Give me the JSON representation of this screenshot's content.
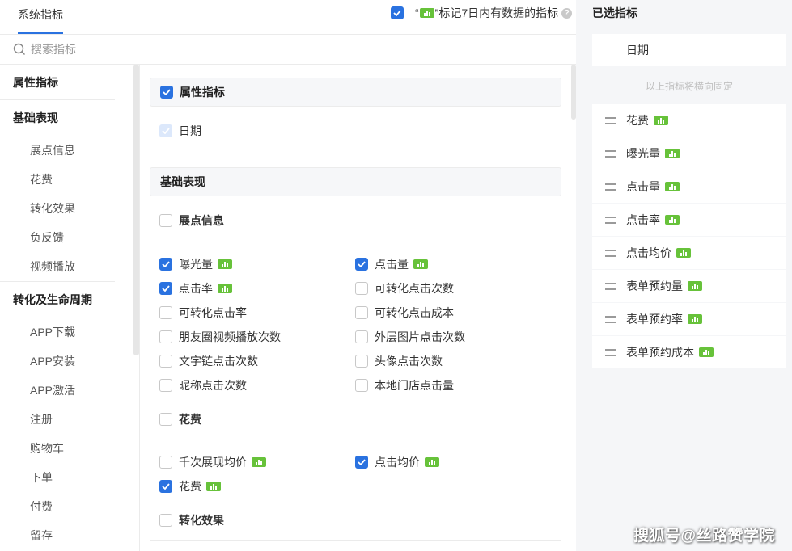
{
  "header": {
    "tab_label": "系统指标",
    "mark_checkbox_checked": true,
    "mark_prefix": "“",
    "mark_suffix": "”标记7日内有数据的指标",
    "help_icon": "question-circle-icon"
  },
  "search": {
    "placeholder": "搜索指标",
    "value": ""
  },
  "nav": {
    "group_attr": "属性指标",
    "group_basic": "基础表现",
    "basic_items": [
      "展点信息",
      "花费",
      "转化效果",
      "负反馈",
      "视频播放"
    ],
    "group_conv": "转化及生命周期",
    "conv_items": [
      "APP下载",
      "APP安装",
      "APP激活",
      "注册",
      "购物车",
      "下单",
      "付费",
      "留存"
    ]
  },
  "main": {
    "attr_section": "属性指标",
    "date_label": "日期",
    "basic_section": "基础表现",
    "exposure_group": "展点信息",
    "exposure_items": [
      {
        "label": "曝光量",
        "checked": true,
        "badge": true
      },
      {
        "label": "点击量",
        "checked": true,
        "badge": true
      },
      {
        "label": "点击率",
        "checked": true,
        "badge": true
      },
      {
        "label": "可转化点击次数",
        "checked": false,
        "badge": false
      },
      {
        "label": "可转化点击率",
        "checked": false,
        "badge": false
      },
      {
        "label": "可转化点击成本",
        "checked": false,
        "badge": false
      },
      {
        "label": "朋友圈视频播放次数",
        "checked": false,
        "badge": false
      },
      {
        "label": "外层图片点击次数",
        "checked": false,
        "badge": false
      },
      {
        "label": "文字链点击次数",
        "checked": false,
        "badge": false
      },
      {
        "label": "头像点击次数",
        "checked": false,
        "badge": false
      },
      {
        "label": "昵称点击次数",
        "checked": false,
        "badge": false
      },
      {
        "label": "本地门店点击量",
        "checked": false,
        "badge": false
      }
    ],
    "cost_group": "花费",
    "cost_items": [
      {
        "label": "千次展现均价",
        "checked": false,
        "badge": true
      },
      {
        "label": "点击均价",
        "checked": true,
        "badge": true
      },
      {
        "label": "花费",
        "checked": true,
        "badge": true
      }
    ],
    "conv_group": "转化效果"
  },
  "right": {
    "title": "已选指标",
    "fixed_item": "日期",
    "fixed_note": "以上指标将横向固定",
    "selected": [
      {
        "label": "花费"
      },
      {
        "label": "曝光量"
      },
      {
        "label": "点击量"
      },
      {
        "label": "点击率"
      },
      {
        "label": "点击均价"
      },
      {
        "label": "表单预约量"
      },
      {
        "label": "表单预约率"
      },
      {
        "label": "表单预约成本"
      }
    ]
  },
  "watermark": "搜狐号@丝路赞学院",
  "colors": {
    "accent": "#2a72e0",
    "badge": "#67c23a",
    "panel_bg": "#f5f6f8"
  }
}
